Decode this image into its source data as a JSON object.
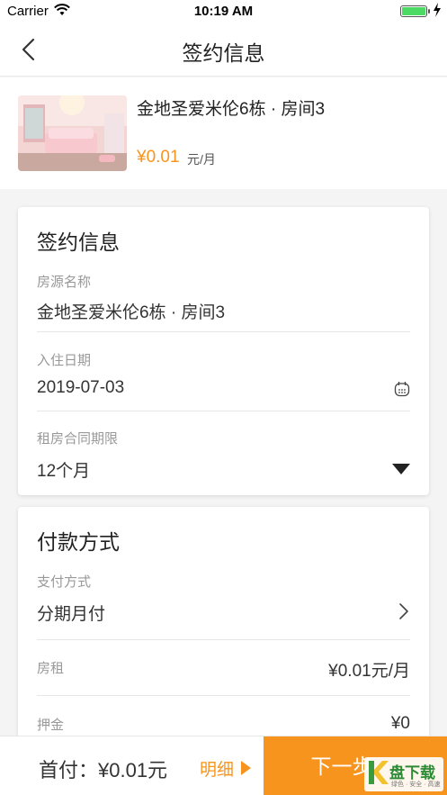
{
  "status_bar": {
    "carrier": "Carrier",
    "time": "10:19 AM",
    "icons": [
      "wifi-icon",
      "battery-icon",
      "charging-icon"
    ]
  },
  "nav": {
    "title": "签约信息",
    "back_icon": "chevron-left-icon"
  },
  "summary": {
    "name": "金地圣爱米伦6栋 · 房间3",
    "price": "¥0.01",
    "unit": "元/月"
  },
  "sign_card": {
    "title": "签约信息",
    "fields": [
      {
        "label": "房源名称",
        "value": "金地圣爱米伦6栋 · 房间3"
      },
      {
        "label": "入住日期",
        "value": "2019-07-03",
        "icon": "calendar-icon"
      },
      {
        "label": "租房合同期限",
        "value": "12个月",
        "icon": "dropdown-triangle-icon"
      }
    ]
  },
  "payment_card": {
    "title": "付款方式",
    "method_label": "支付方式",
    "method_value": "分期月付",
    "rent_label": "房租",
    "rent_value": "¥0.01元/月",
    "deposit_label": "押金",
    "deposit_value": "¥0"
  },
  "bottom": {
    "first_pay": "首付：¥0.01元",
    "detail": "明细",
    "next": "下一步"
  },
  "watermark": {
    "text": "盘下载",
    "sub": "绿色 · 安全 · 高速"
  },
  "colors": {
    "accent": "#f7941d",
    "background": "#f4f4f4",
    "card": "#ffffff"
  }
}
